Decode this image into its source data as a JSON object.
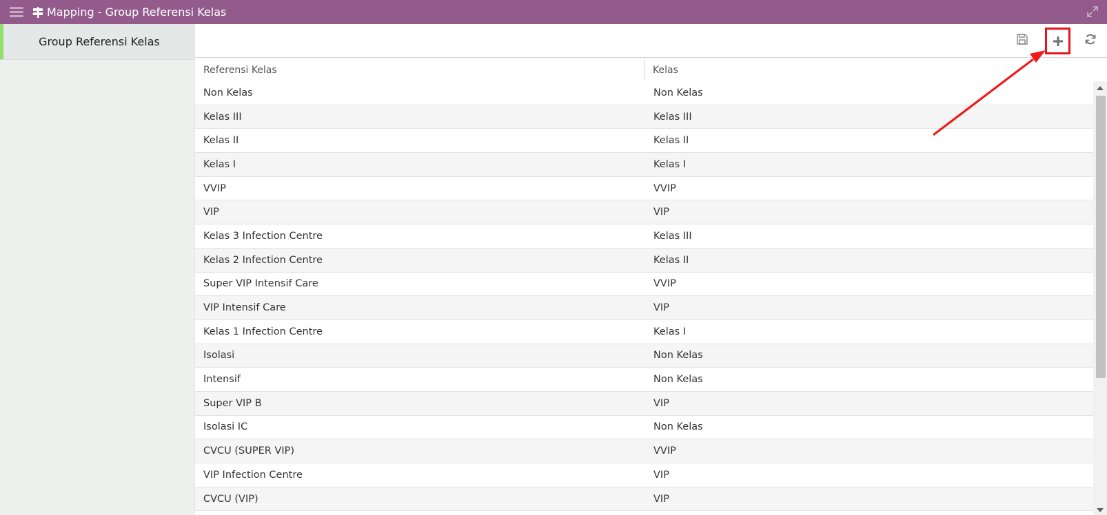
{
  "window": {
    "title": "Mapping - Group Referensi Kelas",
    "title_icon": "signpost-icon",
    "menu_icon": "hamburger-menu-icon",
    "expand_icon": "expand-icon"
  },
  "sidebar": {
    "items": [
      {
        "label": "Group Referensi Kelas",
        "active": true
      }
    ]
  },
  "toolbar": {
    "buttons": [
      {
        "name": "save",
        "icon": "save-icon"
      },
      {
        "name": "add",
        "icon": "plus-icon",
        "highlighted": true
      },
      {
        "name": "refresh",
        "icon": "refresh-icon"
      }
    ]
  },
  "grid": {
    "columns": [
      "Referensi Kelas",
      "Kelas"
    ],
    "rows": [
      [
        "Non Kelas",
        "Non Kelas"
      ],
      [
        "Kelas III",
        "Kelas III"
      ],
      [
        "Kelas II",
        "Kelas II"
      ],
      [
        "Kelas I",
        "Kelas I"
      ],
      [
        "VVIP",
        "VVIP"
      ],
      [
        "VIP",
        "VIP"
      ],
      [
        "Kelas 3 Infection Centre",
        "Kelas III"
      ],
      [
        "Kelas 2 Infection Centre",
        "Kelas II"
      ],
      [
        "Super VIP Intensif Care",
        "VVIP"
      ],
      [
        "VIP Intensif Care",
        "VIP"
      ],
      [
        "Kelas 1 Infection Centre",
        "Kelas I"
      ],
      [
        "Isolasi",
        "Non Kelas"
      ],
      [
        "Intensif",
        "Non Kelas"
      ],
      [
        "Super VIP B",
        "VIP"
      ],
      [
        "Isolasi IC",
        "Non Kelas"
      ],
      [
        "CVCU (SUPER VIP)",
        "VVIP"
      ],
      [
        "VIP Infection Centre",
        "VIP"
      ],
      [
        "CVCU (VIP)",
        "VIP"
      ],
      [
        "",
        ""
      ]
    ]
  },
  "colors": {
    "titlebar": "#935b8b",
    "sidebar_accent": "#8ee06a",
    "highlight": "#e8141b"
  }
}
